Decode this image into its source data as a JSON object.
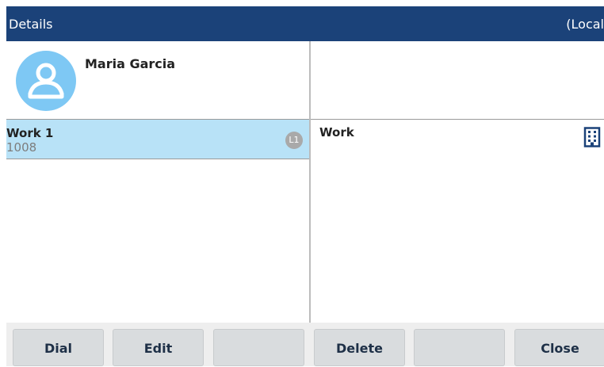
{
  "header": {
    "title": "Details",
    "scope": "(Local"
  },
  "contact": {
    "name": "Maria Garcia"
  },
  "entries": [
    {
      "label": "Work 1",
      "number": "1008",
      "line": "L1"
    }
  ],
  "detail": {
    "type": "Work",
    "icon": "building-icon"
  },
  "softkeys": [
    "Dial",
    "Edit",
    "",
    "Delete",
    "",
    "Close"
  ],
  "colors": {
    "header_bg": "#1b4279",
    "selected_row": "#b8e2f7",
    "avatar": "#7ec8f4",
    "accent_icon": "#1b4279",
    "softkey_text": "#1e3047"
  }
}
